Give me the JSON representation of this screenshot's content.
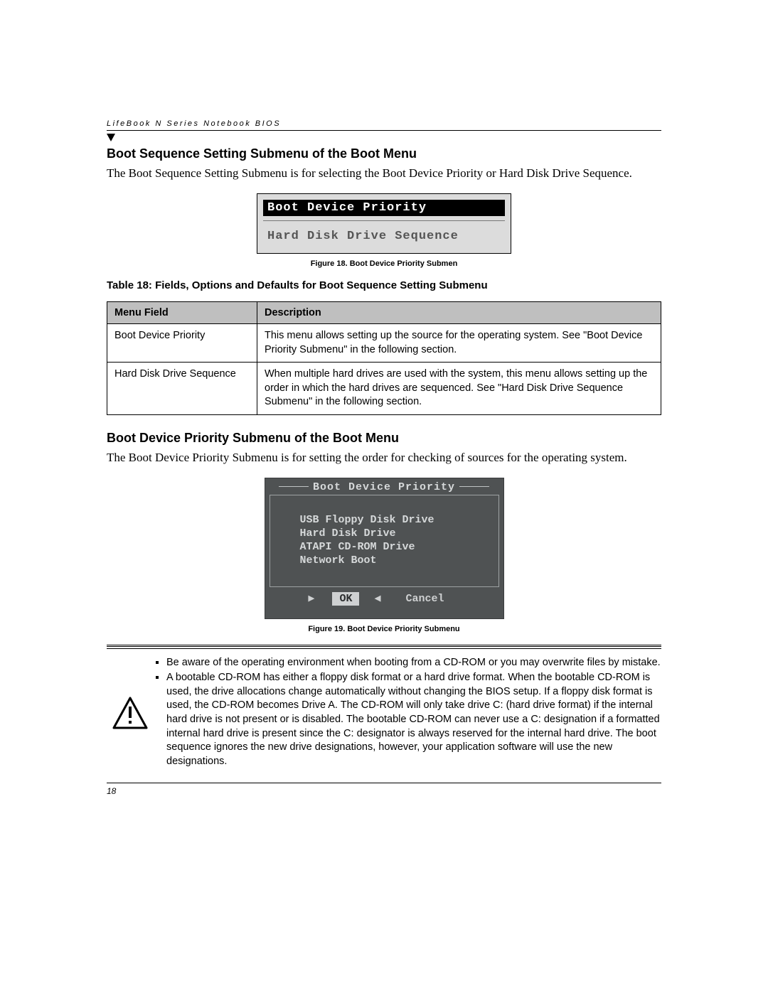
{
  "header_text": "LifeBook N Series Notebook BIOS",
  "section1": {
    "title": "Boot Sequence Setting Submenu of the Boot Menu",
    "body": "The Boot Sequence Setting Submenu is for selecting the Boot Device Priority or Hard Disk Drive Sequence."
  },
  "fig18": {
    "row_selected": "Boot Device Priority",
    "row_other": "Hard Disk Drive Sequence",
    "caption": "Figure 18.  Boot Device Priority Submen"
  },
  "table18": {
    "caption": "Table 18: Fields, Options and Defaults for Boot Sequence Setting Submenu",
    "headers": [
      "Menu Field",
      "Description"
    ],
    "rows": [
      {
        "field": "Boot Device Priority",
        "desc": "This menu allows setting up the source for the operating system. See \"Boot Device Priority Submenu\" in the following section."
      },
      {
        "field": "Hard Disk Drive Sequence",
        "desc": "When multiple hard drives are used with the system, this menu allows setting up the order in which the hard drives are sequenced. See \"Hard Disk Drive Sequence Submenu\" in the following section."
      }
    ]
  },
  "section2": {
    "title": "Boot Device Priority Submenu of the Boot Menu",
    "body": "The Boot Device Priority Submenu is for setting the order for checking of sources for the operating system."
  },
  "fig19": {
    "title": "Boot Device Priority",
    "items": [
      "USB Floppy Disk Drive",
      "Hard Disk Drive",
      "ATAPI CD-ROM Drive",
      "Network Boot"
    ],
    "ok": "OK",
    "cancel": "Cancel",
    "caption": "Figure 19.  Boot Device Priority Submenu"
  },
  "warning": {
    "bullets": [
      "Be aware of the operating environment when booting from a CD-ROM or you may overwrite files by mistake.",
      "A bootable CD-ROM has either a floppy disk format or a hard drive format. When the bootable CD-ROM is used, the drive allocations change automatically without changing the BIOS setup. If a floppy disk format is used, the CD-ROM becomes Drive A. The CD-ROM will only take drive C: (hard drive format) if the internal hard drive is not present or is disabled. The bootable CD-ROM can never use a C: designation if a formatted internal hard drive is present since the C: designator is always reserved for the internal hard drive. The boot sequence ignores the new drive designations, however, your application software will use the new designations."
    ]
  },
  "page_number": "18"
}
